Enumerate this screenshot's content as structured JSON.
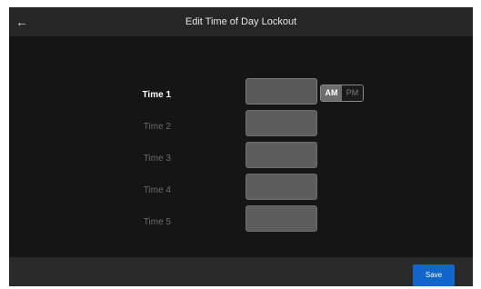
{
  "header": {
    "back_icon": "arrow-left-icon",
    "back_glyph": "←",
    "title": "Edit Time of Day Lockout"
  },
  "times": [
    {
      "label": "Time 1",
      "value": ""
    },
    {
      "label": "Time 2",
      "value": ""
    },
    {
      "label": "Time 3",
      "value": ""
    },
    {
      "label": "Time 4",
      "value": ""
    },
    {
      "label": "Time 5",
      "value": ""
    }
  ],
  "ampm": {
    "am": "AM",
    "pm": "PM",
    "selected": "AM"
  },
  "footer": {
    "save_label": "Save"
  },
  "colors": {
    "accent": "#1166cc",
    "background": "#151515",
    "field": "#5d5d5d"
  }
}
